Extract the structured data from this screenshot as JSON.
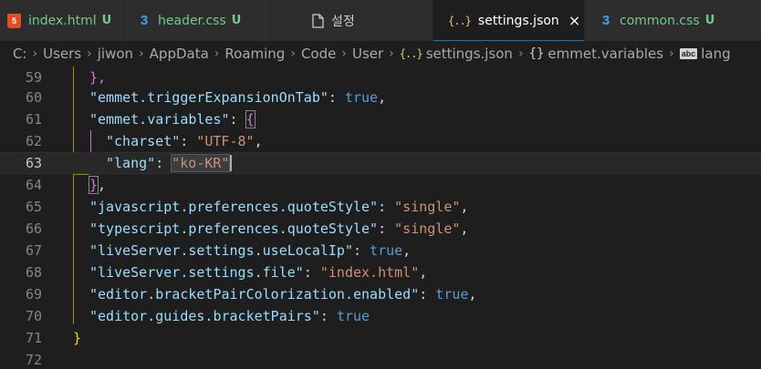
{
  "tabs": [
    {
      "name": "index.html",
      "status": "U",
      "icon": "html5-icon"
    },
    {
      "name": "header.css",
      "status": "U",
      "icon": "css3-icon"
    },
    {
      "name": "설정",
      "status": "",
      "icon": "file-icon"
    },
    {
      "name": "settings.json",
      "status": "",
      "icon": "json-braces-icon",
      "close": "×"
    },
    {
      "name": "common.css",
      "status": "U",
      "icon": "css3-icon"
    }
  ],
  "breadcrumb": {
    "items": [
      "C:",
      "Users",
      "jiwon",
      "AppData",
      "Roaming",
      "Code",
      "User",
      "settings.json",
      "emmet.variables",
      "lang"
    ],
    "separator": "›",
    "json_icon": "{..}",
    "object_icon": "{}",
    "string_icon": "abc"
  },
  "editor": {
    "current_line": 63,
    "lines": [
      {
        "n": "59"
      },
      {
        "n": "60"
      },
      {
        "n": "61"
      },
      {
        "n": "62"
      },
      {
        "n": "63"
      },
      {
        "n": "64"
      },
      {
        "n": "65"
      },
      {
        "n": "66"
      },
      {
        "n": "67"
      },
      {
        "n": "68"
      },
      {
        "n": "69"
      },
      {
        "n": "70"
      },
      {
        "n": "71"
      },
      {
        "n": "72"
      }
    ],
    "text": {
      "l59_close": "},",
      "l60_key": "\"emmet.triggerExpansionOnTab\"",
      "l60_val": "true",
      "l61_key": "\"emmet.variables\"",
      "l61_open": "{",
      "l62_key": "\"charset\"",
      "l62_val": "\"UTF-8\"",
      "l63_key": "\"lang\"",
      "l63_val": "\"ko-KR\"",
      "l64_close": "}",
      "l65_key": "\"javascript.preferences.quoteStyle\"",
      "l65_val": "\"single\"",
      "l66_key": "\"typescript.preferences.quoteStyle\"",
      "l66_val": "\"single\"",
      "l67_key": "\"liveServer.settings.useLocalIp\"",
      "l67_val": "true",
      "l68_key": "\"liveServer.settings.file\"",
      "l68_val": "\"index.html\"",
      "l69_key": "\"editor.bracketPairColorization.enabled\"",
      "l69_val": "true",
      "l70_key": "\"editor.guides.bracketPairs\"",
      "l70_val": "true",
      "l71_close": "}",
      "colon": ": ",
      "comma": ","
    }
  },
  "colors": {
    "key": "#9cdcfe",
    "string": "#ce9178",
    "boolean": "#569cd6",
    "bracket_level1": "#ffd700",
    "bracket_level2": "#da70d6",
    "untracked": "#73c991",
    "html_icon": "#e44d26",
    "css_icon": "#3ba2f4",
    "json_icon": "#e5c07b"
  }
}
